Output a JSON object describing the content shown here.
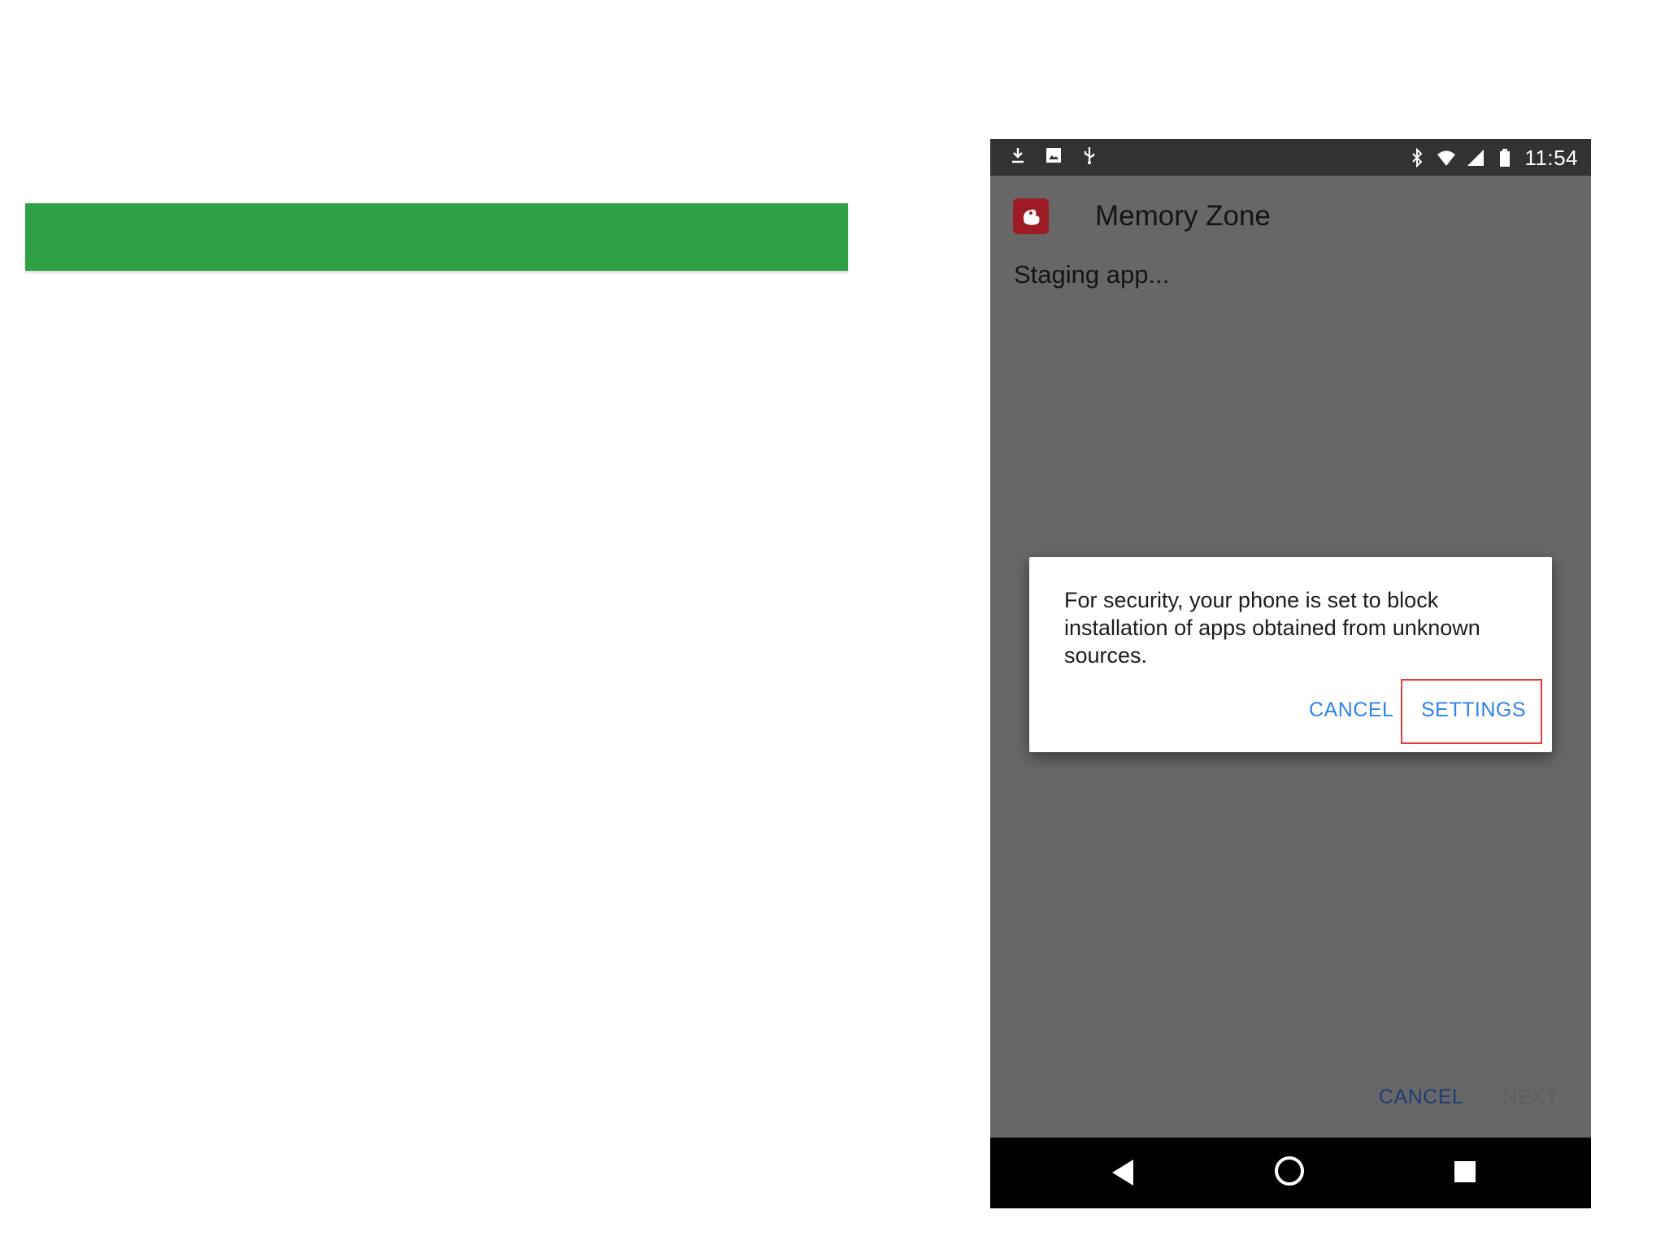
{
  "status_bar": {
    "time": "11:54",
    "left_icons": [
      "download-icon",
      "image-icon",
      "usb-icon"
    ],
    "right_icons": [
      "bluetooth-icon",
      "wifi-icon",
      "signal-icon",
      "battery-icon"
    ]
  },
  "app": {
    "title": "Memory Zone",
    "subtitle": "Staging app..."
  },
  "dialog": {
    "message": "For security, your phone is set to block installation of apps obtained from unknown sources.",
    "cancel_label": "CANCEL",
    "settings_label": "SETTINGS",
    "highlight_color": "#e53c3c"
  },
  "bottom_actions": {
    "cancel_label": "CANCEL",
    "next_label": "NEXT"
  },
  "navigation": {
    "buttons": [
      "back-icon",
      "home-icon",
      "recent-apps-icon"
    ]
  },
  "colors": {
    "banner_green": "#2fa043",
    "dialog_button_blue": "#2f82ee",
    "scrim_gray": "#676767"
  }
}
